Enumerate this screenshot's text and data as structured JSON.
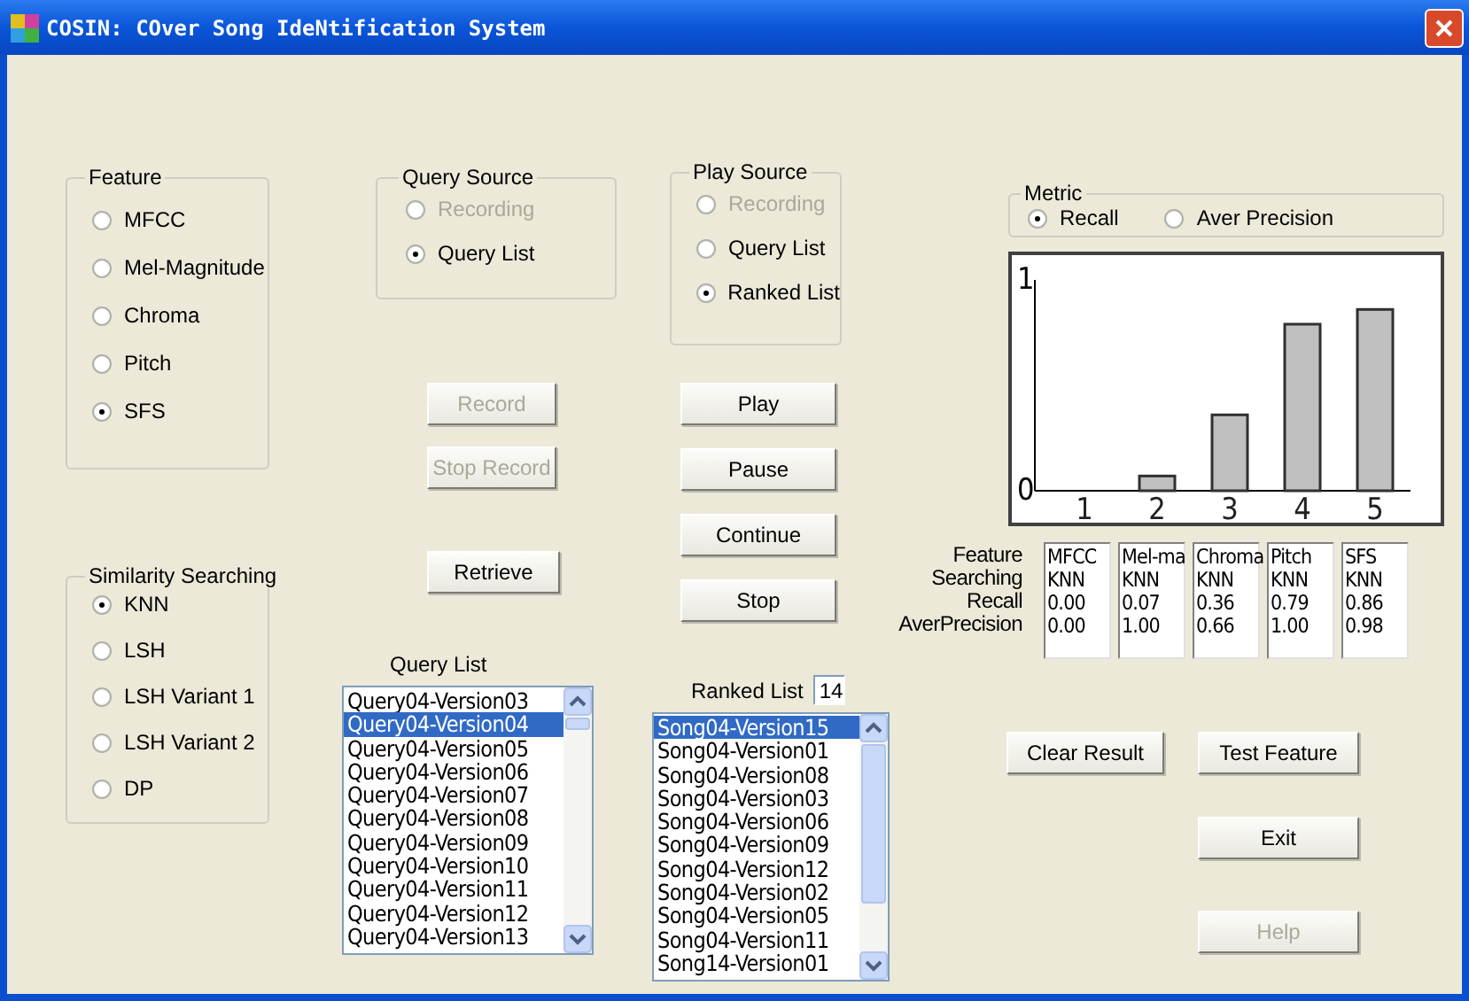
{
  "window": {
    "title": "COSIN: COver Song IdeNtification System"
  },
  "feature": {
    "label": "Feature",
    "options": [
      {
        "label": "MFCC",
        "selected": false,
        "disabled": false
      },
      {
        "label": "Mel-Magnitude",
        "selected": false,
        "disabled": false
      },
      {
        "label": "Chroma",
        "selected": false,
        "disabled": false
      },
      {
        "label": "Pitch",
        "selected": false,
        "disabled": false
      },
      {
        "label": "SFS",
        "selected": true,
        "disabled": false
      }
    ]
  },
  "similarity_searching": {
    "label": "Similarity Searching",
    "options": [
      {
        "label": "KNN",
        "selected": true,
        "disabled": false
      },
      {
        "label": "LSH",
        "selected": false,
        "disabled": false
      },
      {
        "label": "LSH Variant 1",
        "selected": false,
        "disabled": false
      },
      {
        "label": "LSH Variant 2",
        "selected": false,
        "disabled": false
      },
      {
        "label": "DP",
        "selected": false,
        "disabled": false
      }
    ]
  },
  "query_source": {
    "label": "Query Source",
    "options": [
      {
        "label": "Recording",
        "selected": false,
        "disabled": true
      },
      {
        "label": "Query List",
        "selected": true,
        "disabled": false
      }
    ]
  },
  "record_buttons": [
    {
      "label": "Record",
      "disabled": true
    },
    {
      "label": "Stop Record",
      "disabled": true
    }
  ],
  "retrieve_button": {
    "label": "Retrieve",
    "disabled": false
  },
  "query_list": {
    "label": "Query List",
    "items": [
      {
        "text": "Query04-Version03",
        "selected": false
      },
      {
        "text": "Query04-Version04",
        "selected": true
      },
      {
        "text": "Query04-Version05",
        "selected": false
      },
      {
        "text": "Query04-Version06",
        "selected": false
      },
      {
        "text": "Query04-Version07",
        "selected": false
      },
      {
        "text": "Query04-Version08",
        "selected": false
      },
      {
        "text": "Query04-Version09",
        "selected": false
      },
      {
        "text": "Query04-Version10",
        "selected": false
      },
      {
        "text": "Query04-Version11",
        "selected": false
      },
      {
        "text": "Query04-Version12",
        "selected": false
      },
      {
        "text": "Query04-Version13",
        "selected": false
      }
    ]
  },
  "play_source": {
    "label": "Play Source",
    "options": [
      {
        "label": "Recording",
        "selected": false,
        "disabled": true
      },
      {
        "label": "Query List",
        "selected": false,
        "disabled": false
      },
      {
        "label": "Ranked List",
        "selected": true,
        "disabled": false
      }
    ]
  },
  "playback_buttons": [
    {
      "label": "Play",
      "disabled": false
    },
    {
      "label": "Pause",
      "disabled": false
    },
    {
      "label": "Continue",
      "disabled": false
    },
    {
      "label": "Stop",
      "disabled": false
    }
  ],
  "ranked_list": {
    "label": "Ranked List",
    "count": "14",
    "items": [
      {
        "text": "Song04-Version15",
        "selected": true
      },
      {
        "text": "Song04-Version01",
        "selected": false
      },
      {
        "text": "Song04-Version08",
        "selected": false
      },
      {
        "text": "Song04-Version03",
        "selected": false
      },
      {
        "text": "Song04-Version06",
        "selected": false
      },
      {
        "text": "Song04-Version09",
        "selected": false
      },
      {
        "text": "Song04-Version12",
        "selected": false
      },
      {
        "text": "Song04-Version02",
        "selected": false
      },
      {
        "text": "Song04-Version05",
        "selected": false
      },
      {
        "text": "Song04-Version11",
        "selected": false
      },
      {
        "text": "Song14-Version01",
        "selected": false
      }
    ]
  },
  "metric": {
    "label": "Metric",
    "options": [
      {
        "label": "Recall",
        "selected": true,
        "disabled": false
      },
      {
        "label": "Aver Precision",
        "selected": false,
        "disabled": false
      }
    ]
  },
  "chart": {
    "chart_data": {
      "type": "bar",
      "categories": [
        "1",
        "2",
        "3",
        "4",
        "5"
      ],
      "values": [
        0.0,
        0.07,
        0.36,
        0.79,
        0.86
      ],
      "ylim": [
        0,
        1
      ],
      "yticks": [
        0,
        1
      ]
    }
  },
  "results": {
    "row_labels": [
      "Feature",
      "Searching",
      "Recall",
      "AverPrecision"
    ],
    "columns": [
      {
        "values": [
          "MFCC",
          "KNN",
          "0.00",
          "0.00"
        ]
      },
      {
        "values": [
          "Mel-ma",
          "KNN",
          "0.07",
          "1.00"
        ]
      },
      {
        "values": [
          "Chroma",
          "KNN",
          "0.36",
          "0.66"
        ]
      },
      {
        "values": [
          "Pitch",
          "KNN",
          "0.79",
          "1.00"
        ]
      },
      {
        "values": [
          "SFS",
          "KNN",
          "0.86",
          "0.98"
        ]
      }
    ]
  },
  "action_buttons": [
    {
      "label": "Clear Result",
      "disabled": false
    },
    {
      "label": "Test Feature",
      "disabled": false
    },
    {
      "label": "Exit",
      "disabled": false
    },
    {
      "label": "Help",
      "disabled": true
    }
  ]
}
